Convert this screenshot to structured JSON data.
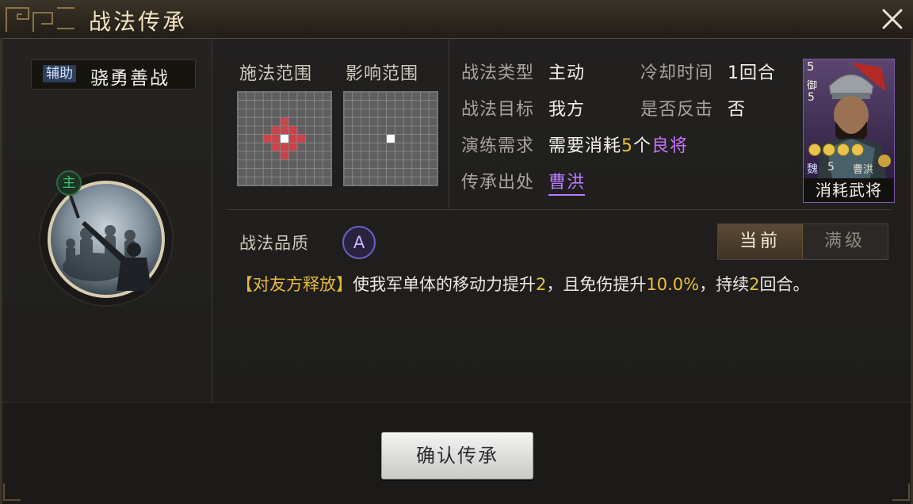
{
  "window": {
    "title": "战法传承"
  },
  "skill": {
    "type_badge": "辅助",
    "name": "骁勇善战",
    "role_badge": "主"
  },
  "ranges": {
    "cast_label": "施法范围",
    "effect_label": "影响范围",
    "cast_red_cells": [
      [
        5,
        5
      ],
      [
        4,
        5
      ],
      [
        6,
        5
      ],
      [
        5,
        4
      ],
      [
        5,
        6
      ],
      [
        3,
        5
      ],
      [
        7,
        5
      ],
      [
        5,
        3
      ],
      [
        5,
        7
      ],
      [
        4,
        4
      ],
      [
        4,
        6
      ],
      [
        6,
        4
      ],
      [
        6,
        6
      ]
    ],
    "cast_center": [
      5,
      5
    ],
    "effect_center": [
      5,
      5
    ]
  },
  "info": {
    "type_label": "战法类型",
    "type_value": "主动",
    "cooldown_label": "冷却时间",
    "cooldown_value": "1回合",
    "target_label": "战法目标",
    "target_value": "我方",
    "counter_label": "是否反击",
    "counter_value": "否",
    "req_label": "演练需求",
    "req_prefix": "需要消耗",
    "req_count": "5",
    "req_unit": "个",
    "req_quality": "良将",
    "source_label": "传承出处",
    "source_value": "曹洪"
  },
  "general_card": {
    "cost": "5",
    "troop": "御",
    "faction": "魏",
    "level": "5",
    "name": "曹洪",
    "stars": 4,
    "footer": "消耗武将"
  },
  "quality": {
    "label": "战法品质",
    "grade": "A"
  },
  "tabs": {
    "current": "当前",
    "max": "满级"
  },
  "description": {
    "trigger": "【对友方释放】",
    "part1": "使我军单体的移动力提升",
    "move_value": "2",
    "part2": "，且免伤提升",
    "dmg_value": "10.0%",
    "part3": "，持续",
    "duration": "2",
    "part4": "回合。"
  },
  "confirm_button": "确认传承",
  "colors": {
    "accent_gold": "#e9c23a",
    "quality_purple": "#c874ff",
    "range_red": "#c9434a"
  }
}
